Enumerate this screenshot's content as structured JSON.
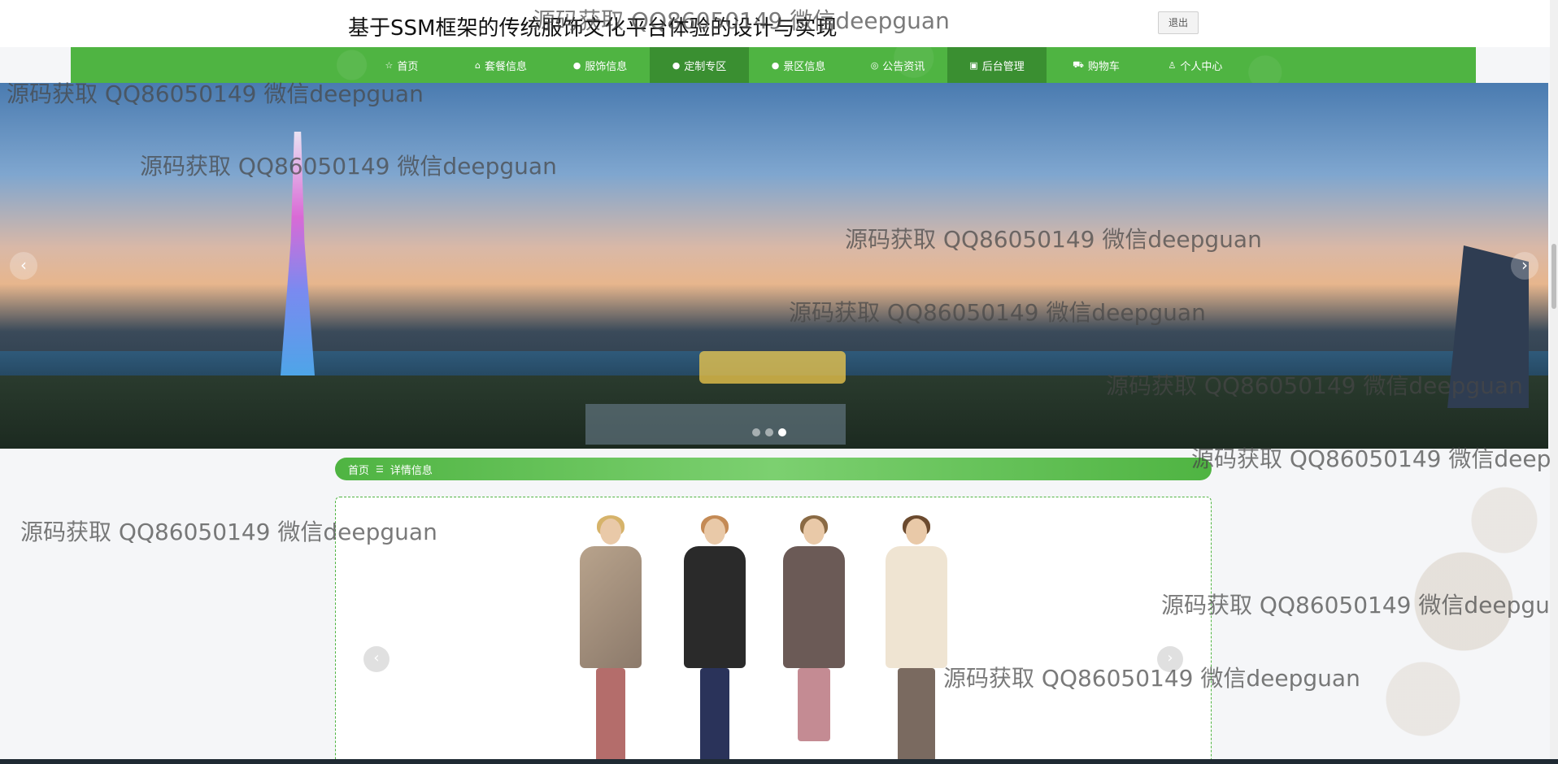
{
  "header": {
    "title": "基于SSM框架的传统服饰文化平台体验的设计与实现",
    "logout_label": "退出"
  },
  "nav": {
    "items": [
      {
        "label": "首页",
        "icon": "star-icon"
      },
      {
        "label": "套餐信息",
        "icon": "lock-icon"
      },
      {
        "label": "服饰信息",
        "icon": "info-circle-icon"
      },
      {
        "label": "定制专区",
        "icon": "help-circle-icon",
        "active": true
      },
      {
        "label": "景区信息",
        "icon": "info-circle-icon"
      },
      {
        "label": "公告资讯",
        "icon": "globe-icon"
      },
      {
        "label": "后台管理",
        "icon": "building-icon"
      },
      {
        "label": "购物车",
        "icon": "cart-icon"
      },
      {
        "label": "个人中心",
        "icon": "user-icon"
      }
    ],
    "active_color": "#3a8f31",
    "bar_color": "#4fb442"
  },
  "banner": {
    "prev_label": "‹",
    "next_label": "›",
    "slide_count": 3,
    "active_slide": 3
  },
  "breadcrumb": {
    "home": "首页",
    "separator": "☰",
    "current": "详情信息"
  },
  "detail": {
    "prev_label": "‹",
    "next_label": "›"
  },
  "watermark": {
    "text": "源码获取 QQ86050149 微信deepguan"
  }
}
